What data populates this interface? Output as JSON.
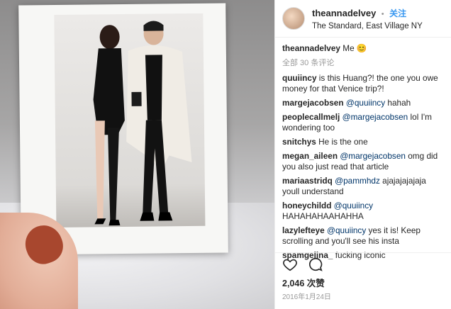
{
  "post": {
    "username": "theannadelvey",
    "follow_label": "关注",
    "location": "The Standard, East Village NY",
    "caption_user": "theannadelvey",
    "caption_text": "Me 😊",
    "view_all": "全部 30 条评论",
    "comments": [
      {
        "user": "quuiincy",
        "mention": "",
        "text": "is this Huang?! the one you owe money for that Venice trip?!"
      },
      {
        "user": "margejacobsen",
        "mention": "@quuiincy",
        "text": "hahah"
      },
      {
        "user": "peoplecallmelj",
        "mention": "@margejacobsen",
        "text": "lol I'm wondering too"
      },
      {
        "user": "snitchys",
        "mention": "",
        "text": "He is the one"
      },
      {
        "user": "megan_aileen",
        "mention": "@margejacobsen",
        "text": "omg did you also just read that article"
      },
      {
        "user": "mariaastridq",
        "mention": "@pammhdz",
        "text": "ajajajajajaja youll understand"
      },
      {
        "user": "honeychildd",
        "mention": "@quuiincy",
        "text": "HAHAHAHAAHAHHA"
      },
      {
        "user": "lazylefteye",
        "mention": "@quuiincy",
        "text": "yes it is! Keep scrolling and you'll see his insta"
      },
      {
        "user": "spamgelina_",
        "mention": "",
        "text": "fucking iconic"
      }
    ],
    "likes": "2,046 次赞",
    "date": "2016年1月24日"
  },
  "icons": {
    "like": "heart-icon",
    "comment": "comment-icon"
  }
}
